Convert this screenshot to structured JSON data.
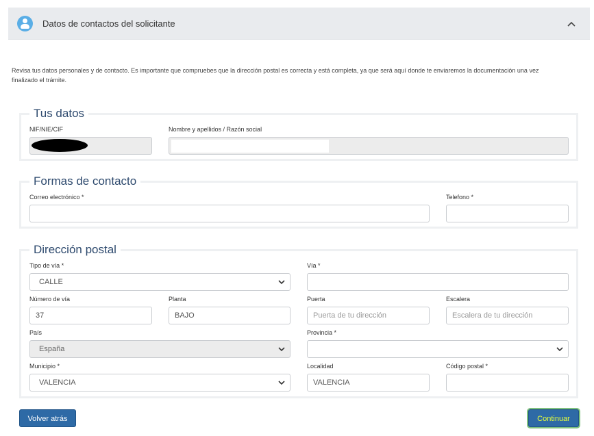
{
  "header": {
    "title": "Datos de contactos del solicitante",
    "icon": "user-icon",
    "toggle_icon": "chevron-up-icon"
  },
  "intro": "Revisa tus datos personales y de contacto. Es importante que compruebes que la dirección postal es correcta y está completa, ya que será aquí donde te enviaremos la documentación una vez finalizado el trámite.",
  "tus_datos": {
    "legend": "Tus datos",
    "nif_label": "NIF/NIE/CIF",
    "nombre_label": "Nombre y apellidos / Razón social"
  },
  "contacto": {
    "legend": "Formas de contacto",
    "email_label": "Correo electrónico *",
    "telefono_label": "Telefono *"
  },
  "direccion": {
    "legend": "Dirección postal",
    "tipo_via_label": "Tipo de vía *",
    "tipo_via_value": "CALLE",
    "via_label": "Vía *",
    "numero_label": "Número de vía",
    "numero_value": "37",
    "planta_label": "Planta",
    "planta_value": "BAJO",
    "puerta_label": "Puerta",
    "puerta_placeholder": "Puerta de tu dirección",
    "escalera_label": "Escalera",
    "escalera_placeholder": "Escalera de tu dirección",
    "pais_label": "País",
    "pais_value": "España",
    "provincia_label": "Provincia *",
    "municipio_label": "Municipio *",
    "municipio_value": "VALENCIA",
    "localidad_label": "Localidad",
    "localidad_value": "VALENCIA",
    "cp_label": "Código postal *"
  },
  "actions": {
    "back_label": "Volver atrás",
    "continue_label": "Continuar"
  },
  "colors": {
    "primary_button": "#2e6aa6",
    "legend": "#2e4a6e",
    "header_bg": "#e9ebee",
    "avatar": "#5aaee6"
  }
}
